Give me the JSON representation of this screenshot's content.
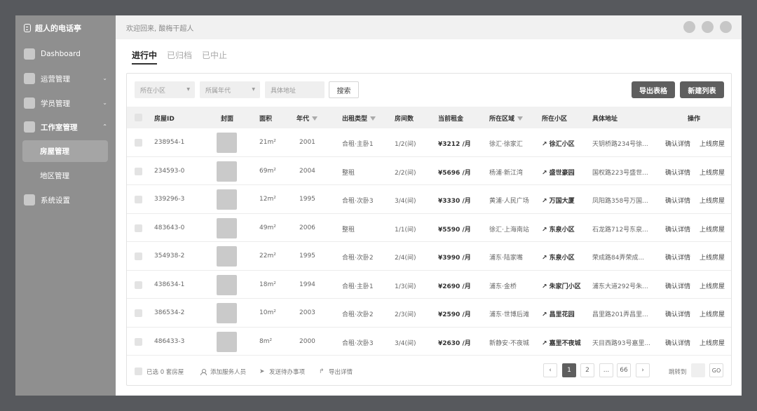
{
  "app": {
    "brand": "超人的电话亭"
  },
  "sidebar": {
    "items": [
      {
        "label": "Dashboard",
        "chevron": ""
      },
      {
        "label": "运营管理",
        "chevron": "⌄"
      },
      {
        "label": "学员管理",
        "chevron": "⌄"
      },
      {
        "label": "工作室管理",
        "chevron": "⌃"
      }
    ],
    "subitems": [
      {
        "label": "房屋管理"
      },
      {
        "label": "地区管理"
      }
    ],
    "settings": {
      "label": "系统设置"
    }
  },
  "header": {
    "welcome": "欢迎回来, 酸梅干超人"
  },
  "tabs": [
    {
      "label": "进行中"
    },
    {
      "label": "已归档"
    },
    {
      "label": "已中止"
    }
  ],
  "filters": {
    "community_placeholder": "所在小区",
    "year_placeholder": "所属年代",
    "address_placeholder": "具体地址",
    "search_label": "搜索",
    "export_label": "导出表格",
    "new_label": "新建列表"
  },
  "table": {
    "headers": {
      "id": "房屋ID",
      "cover": "封面",
      "area": "面积",
      "year": "年代",
      "type": "出租类型",
      "rooms": "房间数",
      "rent": "当前租金",
      "region": "所在区域",
      "community": "所在小区",
      "address": "具体地址",
      "ops": "操作"
    },
    "rows": [
      {
        "id": "238954-1",
        "area": "21m²",
        "year": "2001",
        "type": "合租·主卧1",
        "rooms": "1/2(间)",
        "rent": "¥3212 /月",
        "region": "徐汇·徐家汇",
        "community": "↗ 徐汇小区",
        "address": "天钥桥路234号徐...",
        "op1": "确认详情",
        "op2": "上线房屋"
      },
      {
        "id": "234593-0",
        "area": "69m²",
        "year": "2004",
        "type": "整租",
        "rooms": "2/2(间)",
        "rent": "¥5696 /月",
        "region": "杨浦·新江湾",
        "community": "↗ 盛世豪园",
        "address": "国权路223号盛世...",
        "op1": "确认详情",
        "op2": "上线房屋"
      },
      {
        "id": "339296-3",
        "area": "12m²",
        "year": "1995",
        "type": "合租·次卧3",
        "rooms": "3/4(间)",
        "rent": "¥3330 /月",
        "region": "黄浦·人民广场",
        "community": "↗ 万国大厦",
        "address": "凤阳路358号万国...",
        "op1": "确认详情",
        "op2": "上线房屋"
      },
      {
        "id": "483643-0",
        "area": "49m²",
        "year": "2006",
        "type": "整租",
        "rooms": "1/1(间)",
        "rent": "¥5590 /月",
        "region": "徐汇·上海南站",
        "community": "↗ 东泉小区",
        "address": "石龙路712号东泉...",
        "op1": "确认详情",
        "op2": "上线房屋"
      },
      {
        "id": "354938-2",
        "area": "22m²",
        "year": "1995",
        "type": "合租·次卧2",
        "rooms": "2/4(间)",
        "rent": "¥3990 /月",
        "region": "浦东·陆家嘴",
        "community": "↗ 东泉小区",
        "address": "荣成路84弄荣成...",
        "op1": "确认详情",
        "op2": "上线房屋"
      },
      {
        "id": "438634-1",
        "area": "18m²",
        "year": "1994",
        "type": "合租·主卧1",
        "rooms": "1/3(间)",
        "rent": "¥2690 /月",
        "region": "浦东·金桥",
        "community": "↗ 朱家门小区",
        "address": "浦东大道292号朱...",
        "op1": "确认详情",
        "op2": "上线房屋"
      },
      {
        "id": "386534-2",
        "area": "10m²",
        "year": "2003",
        "type": "合租·次卧2",
        "rooms": "2/3(间)",
        "rent": "¥2590 /月",
        "region": "浦东·世博后滩",
        "community": "↗ 昌里花园",
        "address": "昌里路201弄昌里...",
        "op1": "确认详情",
        "op2": "上线房屋"
      },
      {
        "id": "486433-3",
        "area": "8m²",
        "year": "2000",
        "type": "合租·次卧3",
        "rooms": "3/4(间)",
        "rent": "¥2630 /月",
        "region": "新静安·不夜城",
        "community": "↗ 嘉里不夜城",
        "address": "天目西路93号嘉里...",
        "op1": "确认详情",
        "op2": "上线房屋"
      }
    ]
  },
  "footer": {
    "selected": "已选 0 套房屋",
    "add_staff": "添加服务人员",
    "send_todo": "发送待办事项",
    "export_detail": "导出详情",
    "pages": [
      "1",
      "2",
      "...",
      "66"
    ],
    "prev": "‹",
    "next": "›",
    "jump_label": "跳转到",
    "go_label": "GO"
  },
  "icons": [
    "logo-icon",
    "chevron-down-icon",
    "chevron-up-icon",
    "filter-icon",
    "arrow-up-right-icon",
    "user-icon",
    "send-icon",
    "share-icon"
  ]
}
